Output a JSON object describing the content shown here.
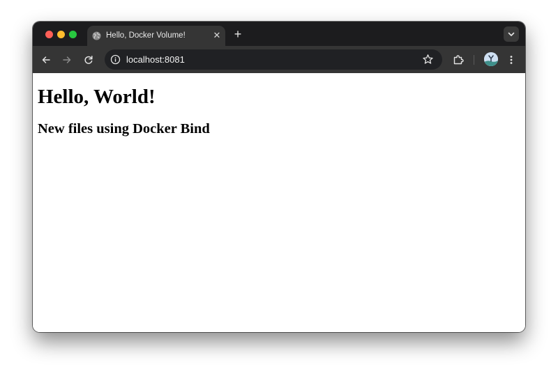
{
  "browser": {
    "tab": {
      "title": "Hello, Docker Volume!",
      "favicon": "globe-icon",
      "close_glyph": "✕"
    },
    "new_tab_glyph": "+",
    "tab_search_icon": "chevron-down-icon",
    "toolbar": {
      "back_icon": "arrow-left-icon",
      "forward_icon": "arrow-right-icon",
      "reload_icon": "reload-icon",
      "site_info_icon": "info-icon",
      "bookmark_icon": "star-icon",
      "extensions_icon": "puzzle-icon",
      "profile_icon": "avatar",
      "menu_icon": "kebab-menu-icon"
    },
    "address_bar": {
      "url": "localhost:8081"
    }
  },
  "page": {
    "heading": "Hello, World!",
    "subheading": "New files using Docker Bind"
  },
  "colors": {
    "tabstrip_bg": "#1c1c1e",
    "toolbar_bg": "#353535",
    "omnibox_bg": "#202124",
    "close_red": "#fe5f57",
    "minimize_yellow": "#febc2e",
    "maximize_green": "#28c840"
  }
}
